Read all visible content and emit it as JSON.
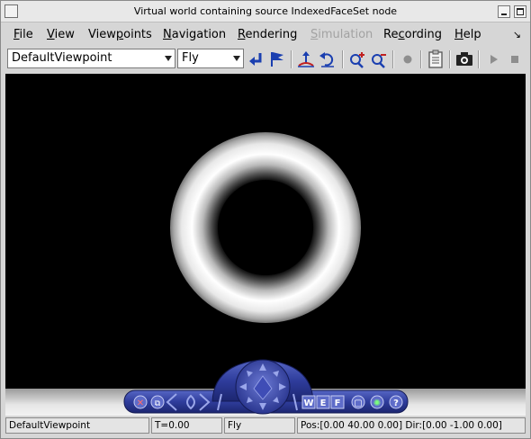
{
  "window": {
    "title": "Virtual world containing source IndexedFaceSet node"
  },
  "menu": {
    "items": [
      {
        "label": "File",
        "mnemonic": "F",
        "rest": "ile",
        "disabled": false
      },
      {
        "label": "View",
        "mnemonic": "V",
        "rest": "iew",
        "disabled": false
      },
      {
        "label": "Viewpoints",
        "pre": "View",
        "mnemonic": "p",
        "rest": "oints",
        "disabled": false
      },
      {
        "label": "Navigation",
        "mnemonic": "N",
        "rest": "avigation",
        "disabled": false
      },
      {
        "label": "Rendering",
        "mnemonic": "R",
        "rest": "endering",
        "disabled": false
      },
      {
        "label": "Simulation",
        "mnemonic": "S",
        "rest": "imulation",
        "disabled": true
      },
      {
        "label": "Recording",
        "pre": "Re",
        "mnemonic": "c",
        "rest": "ording",
        "disabled": false
      },
      {
        "label": "Help",
        "mnemonic": "H",
        "rest": "elp",
        "disabled": false
      }
    ]
  },
  "toolbar": {
    "viewpoint_select": "DefaultViewpoint",
    "navigation_select": "Fly",
    "icons": [
      "go-back-icon",
      "flag-icon",
      "straighten-icon",
      "undo-move-icon",
      "zoom-in-icon",
      "zoom-out-icon",
      "record-icon",
      "clipboard-icon",
      "camera-icon",
      "play-icon",
      "stop-icon"
    ]
  },
  "dashboard": {
    "buttons": [
      {
        "name": "close-icon",
        "glyph": "✕"
      },
      {
        "name": "restore-icon",
        "glyph": "⧉"
      },
      {
        "name": "w-button",
        "glyph": "W"
      },
      {
        "name": "e-button",
        "glyph": "E"
      },
      {
        "name": "f-button",
        "glyph": "F"
      },
      {
        "name": "fit-icon",
        "glyph": "▢"
      },
      {
        "name": "headlight-icon",
        "glyph": "✺"
      },
      {
        "name": "help-icon",
        "glyph": "?"
      }
    ]
  },
  "status": {
    "viewpoint": "DefaultViewpoint",
    "time": "T=0.00",
    "mode": "Fly",
    "position": "Pos:[0.00 40.00 0.00] Dir:[0.00 -1.00 0.00]"
  },
  "colors": {
    "dashboard_blue": "#2f3d9c",
    "toolbar_icon_blue": "#1a3fb0",
    "viewport_bg": "#000000",
    "disabled_text": "#a2a2a2"
  }
}
